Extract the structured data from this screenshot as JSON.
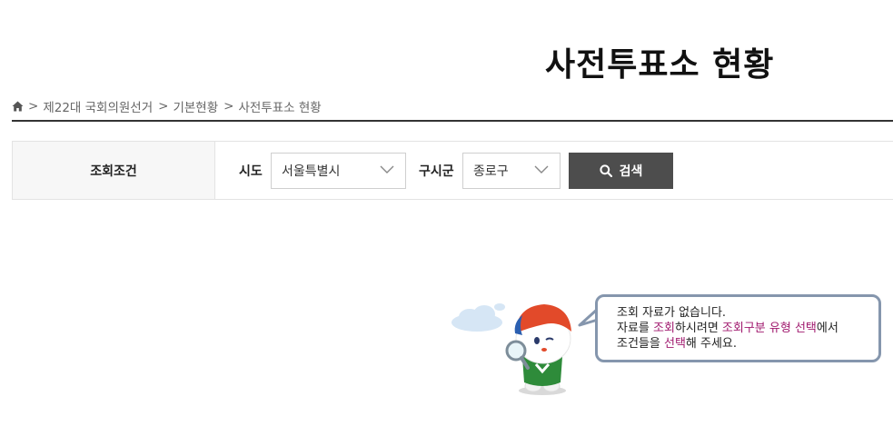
{
  "page_title": "사전투표소 현황",
  "breadcrumb": {
    "items": [
      "제22대 국회의원선거",
      "기본현황",
      "사전투표소 현황"
    ],
    "separator": ">"
  },
  "search": {
    "condition_label": "조회조건",
    "sido_label": "시도",
    "sido_value": "서울특별시",
    "gusigun_label": "구시군",
    "gusigun_value": "종로구",
    "search_button": "검색"
  },
  "message": {
    "line1": "조회 자료가 없습니다.",
    "line2_a": "자료를 ",
    "line2_b": "조회",
    "line2_c": "하시려면 ",
    "line2_d": "조회구분 유형 선택",
    "line2_e": "에서",
    "line3_a": "조건들을 ",
    "line3_b": "선택",
    "line3_c": "해 주세요."
  },
  "colors": {
    "highlight": "#a0196e",
    "button": "#4d4d4d",
    "bubble_border": "#8596ad"
  }
}
